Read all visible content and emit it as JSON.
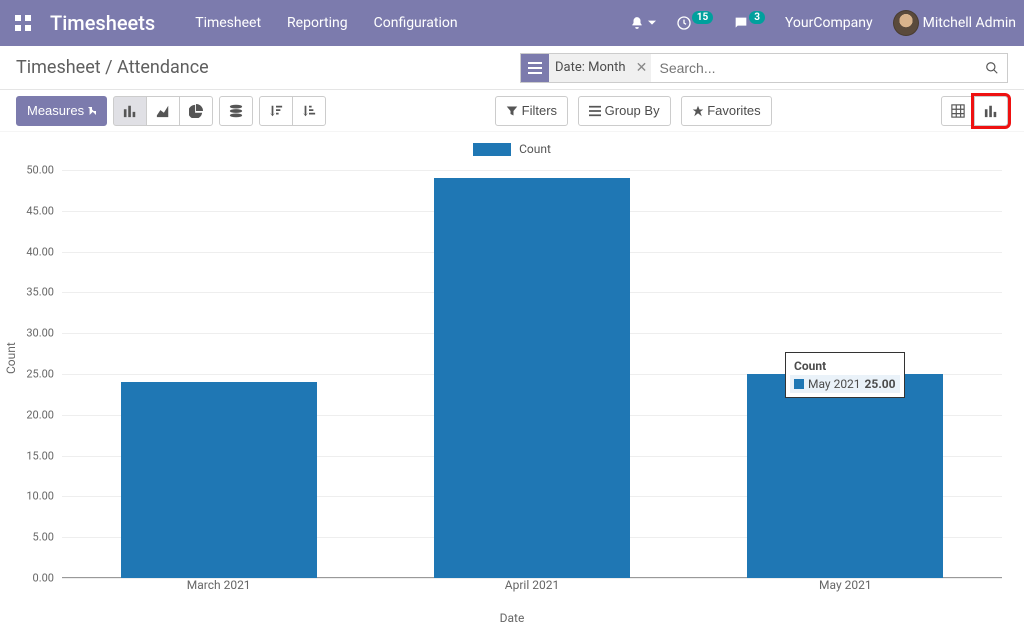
{
  "header": {
    "app_name": "Timesheets",
    "nav": [
      "Timesheet",
      "Reporting",
      "Configuration"
    ],
    "notif_badge": "15",
    "chat_badge": "3",
    "company": "YourCompany",
    "user": "Mitchell Admin"
  },
  "breadcrumb": "Timesheet / Attendance",
  "search": {
    "facet_label": "Date: Month",
    "placeholder": "Search..."
  },
  "toolbar": {
    "measures_label": "Measures",
    "filters_label": "Filters",
    "groupby_label": "Group By",
    "favorites_label": "Favorites"
  },
  "legend_label": "Count",
  "tooltip": {
    "title": "Count",
    "series": "May 2021",
    "value": "25.00"
  },
  "chart_data": {
    "type": "bar",
    "title": "",
    "xlabel": "Date",
    "ylabel": "Count",
    "ylim": [
      0,
      50
    ],
    "ytick_step": 5,
    "categories": [
      "March 2021",
      "April 2021",
      "May 2021"
    ],
    "values": [
      24,
      49,
      25
    ]
  }
}
